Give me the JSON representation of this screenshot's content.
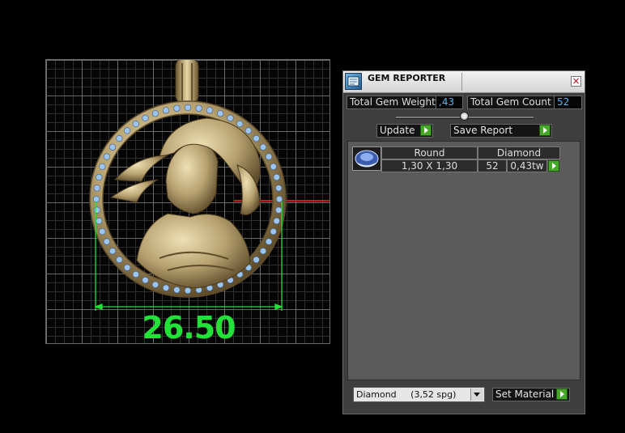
{
  "viewport": {
    "dimension_value": "26.50",
    "colors": {
      "dimension": "#22e23a",
      "metal": "#b7a170",
      "gem": "#9cc4ee",
      "axis": "#d01818"
    }
  },
  "gem_reporter": {
    "title": "GEM REPORTER",
    "close_icon": "close-icon",
    "total_gem_weight_label": "Total Gem Weight",
    "total_gem_weight_value": ",43",
    "total_gem_count_label": "Total Gem Count",
    "total_gem_count_value": "52",
    "update_label": "Update",
    "save_report_label": "Save Report",
    "gems": [
      {
        "thumbnail_icon": "round-gem-icon",
        "shape": "Round",
        "material": "Diamond",
        "size": "1,30 X 1,30",
        "count": "52",
        "weight": "0,43tw"
      }
    ],
    "material_select": {
      "selected": "Diamond     (3,52 spg)"
    },
    "set_material_label": "Set Material",
    "colors": {
      "accent_green": "#45a828",
      "value_blue": "#59b6f0",
      "panel_bg": "#3e3e3e"
    }
  }
}
